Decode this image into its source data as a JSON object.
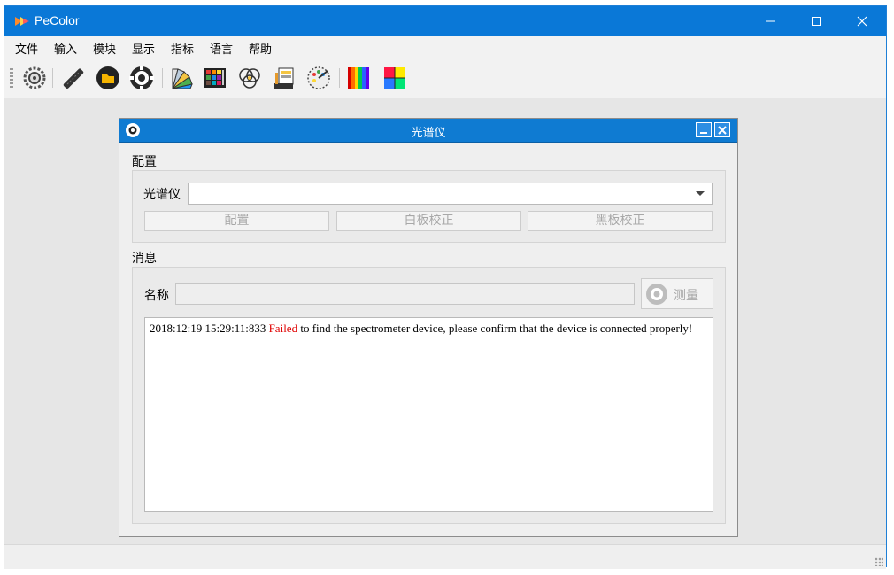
{
  "app": {
    "title": "PeColor"
  },
  "window_controls": {
    "minimize": "—",
    "maximize": "☐",
    "close": "✕"
  },
  "menu": [
    "文件",
    "输入",
    "模块",
    "显示",
    "指标",
    "语言",
    "帮助"
  ],
  "toolbar": {
    "icons": [
      "settings-gear-icon",
      "probe-icon",
      "folder-icon",
      "spectrometer-icon",
      "color-fan-icon",
      "color-chart-icon",
      "rgb-circles-icon",
      "paint-tools-icon",
      "palette-dial-icon",
      "spectrum-bars-icon",
      "color-grid-icon"
    ]
  },
  "dialog": {
    "title": "光谱仪",
    "config_group": {
      "title": "配置",
      "spectrometer_label": "光谱仪",
      "spectrometer_value": "",
      "buttons": {
        "config": "配置",
        "white_calibration": "白板校正",
        "black_calibration": "黑板校正"
      }
    },
    "message_group": {
      "title": "消息",
      "name_label": "名称",
      "name_value": "",
      "measure_button": "测量",
      "log": {
        "timestamp": "2018:12:19 15:29:11:833",
        "status": "Failed",
        "message": "to find the spectrometer device, please confirm that the device is connected properly!"
      }
    }
  },
  "colors": {
    "titlebar": "#0a78d7",
    "dialog_title": "#0f7bd2",
    "error_text": "#e00000"
  }
}
